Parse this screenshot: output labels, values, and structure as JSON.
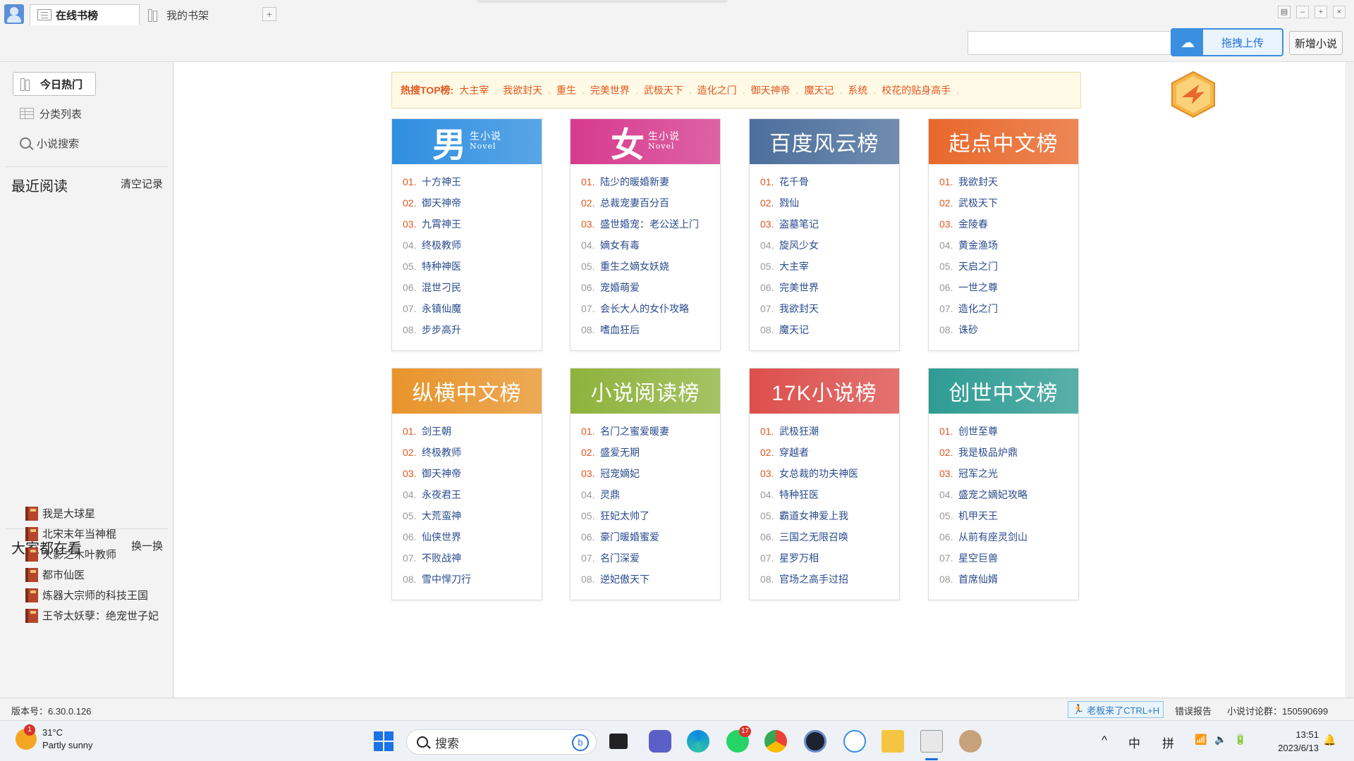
{
  "tabs": [
    {
      "label": "在线书榜",
      "active": true
    },
    {
      "label": "我的书架",
      "active": false
    }
  ],
  "toolbar": {
    "search_value": "",
    "upload_label": "拖拽上传",
    "new_novel_label": "新增小说"
  },
  "sidebar": {
    "nav": [
      {
        "label": "今日热门",
        "icon": "books-icon",
        "active": true
      },
      {
        "label": "分类列表",
        "icon": "grid-icon",
        "active": false
      },
      {
        "label": "小说搜索",
        "icon": "search-icon",
        "active": false
      }
    ],
    "recent_title": "最近阅读",
    "recent_clear": "清空记录",
    "popular_title": "大家都在看",
    "popular_refresh": "换一换",
    "popular": [
      "我是大球星",
      "北宋末年当神棍",
      "火影之木叶教师",
      "都市仙医",
      "炼器大宗师的科技王国",
      "王爷太妖孽：绝宠世子妃"
    ]
  },
  "hot_search": {
    "label": "热搜TOP榜:",
    "items": [
      "大主宰",
      "我欲封天",
      "重生",
      "完美世界",
      "武极天下",
      "造化之门",
      "御天神帝",
      "魔天记",
      "系统",
      "校花的贴身高手"
    ]
  },
  "boards": [
    {
      "title_big": "男",
      "title_small": "生小说",
      "title_en": "Novel",
      "color": "#2f8fe0",
      "items": [
        "十方神王",
        "御天神帝",
        "九霄神王",
        "终极教师",
        "特种神医",
        "混世刁民",
        "永镇仙魔",
        "步步高升"
      ]
    },
    {
      "title_big": "女",
      "title_small": "生小说",
      "title_en": "Novel",
      "color": "#d63b8e",
      "items": [
        "陆少的暖婚新妻",
        "总裁宠妻百分百",
        "盛世婚宠：老公送上门",
        "嫡女有毒",
        "重生之嫡女妖娆",
        "宠婚萌爱",
        "会长大人的女仆攻略",
        "嗜血狂后"
      ]
    },
    {
      "title": "百度风云榜",
      "color": "#4c6f9c",
      "items": [
        "花千骨",
        "戮仙",
        "盗墓笔记",
        "旋风少女",
        "大主宰",
        "完美世界",
        "我欲封天",
        "魔天记"
      ]
    },
    {
      "title": "起点中文榜",
      "color": "#e8682b",
      "items": [
        "我欲封天",
        "武极天下",
        "金陵春",
        "黄金渔场",
        "天启之门",
        "一世之尊",
        "造化之门",
        "诛砂"
      ]
    },
    {
      "title": "纵横中文榜",
      "color": "#e8942b",
      "items": [
        "剑王朝",
        "终极教师",
        "御天神帝",
        "永夜君王",
        "大荒蛮神",
        "仙侠世界",
        "不败战神",
        "雪中悍刀行"
      ]
    },
    {
      "title": "小说阅读榜",
      "color": "#8eb33c",
      "items": [
        "名门之蜜爱暖妻",
        "盛爱无期",
        "冠宠嫡妃",
        "灵鼎",
        "狂妃太帅了",
        "豪门暖婚蜜爱",
        "名门深爱",
        "逆妃傲天下"
      ]
    },
    {
      "title": "17K小说榜",
      "color": "#dc4f4c",
      "items": [
        "武极狂潮",
        "穿越者",
        "女总裁的功夫神医",
        "特种狂医",
        "霸道女神爱上我",
        "三国之无限召唤",
        "星罗万相",
        "官场之高手过招"
      ]
    },
    {
      "title": "创世中文榜",
      "color": "#2e9c93",
      "items": [
        "创世至尊",
        "我是极品炉鼎",
        "冠军之光",
        "盛宠之嫡妃攻略",
        "机甲天王",
        "从前有座灵剑山",
        "星空巨兽",
        "首席仙婿"
      ]
    }
  ],
  "statusbar": {
    "version": "版本号：6.30.0.126",
    "boss_key": "老板来了CTRL+H",
    "error_report": "错误报告",
    "discussion": "小说讨论群：150590699"
  },
  "taskbar": {
    "temperature": "31°C",
    "weather": "Partly sunny",
    "weather_badge": "1",
    "search_placeholder": "搜索",
    "whatsapp_badge": "17",
    "ime_lang": "中",
    "ime_mode": "拼",
    "time": "13:51",
    "date": "2023/6/13"
  }
}
